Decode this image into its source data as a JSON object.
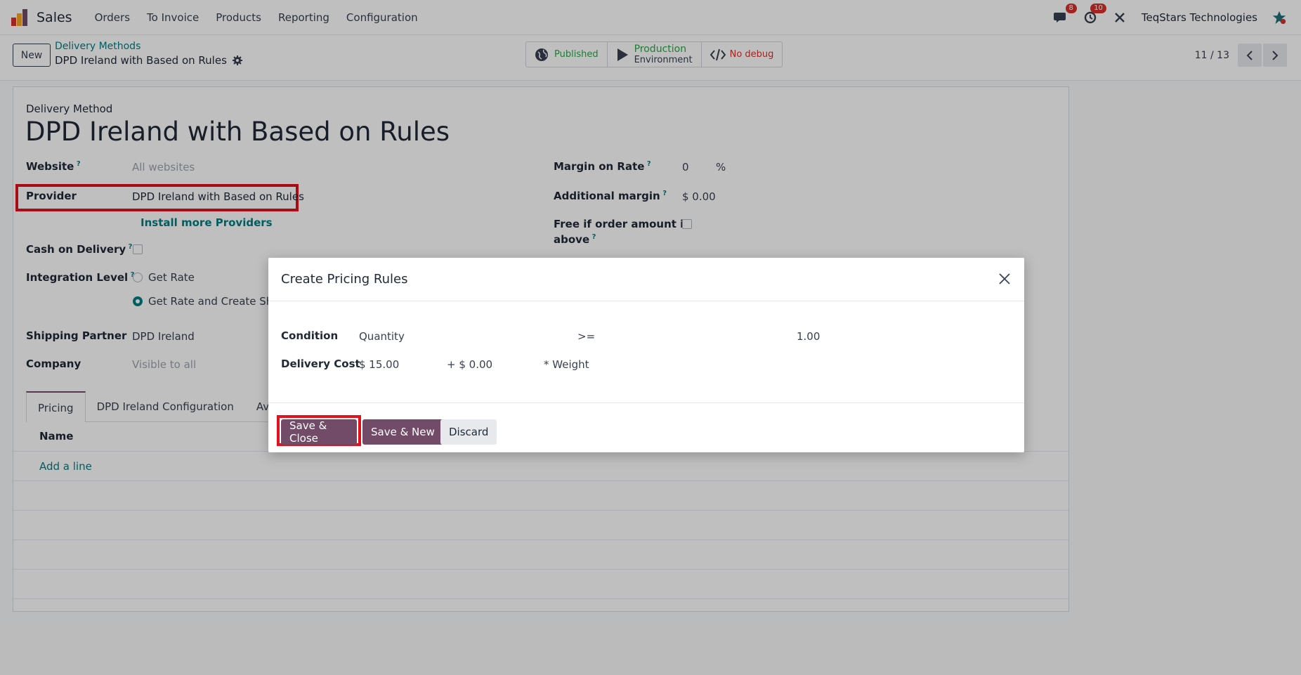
{
  "navbar": {
    "app_name": "Sales",
    "menu": [
      "Orders",
      "To Invoice",
      "Products",
      "Reporting",
      "Configuration"
    ],
    "messages_count": "8",
    "activities_count": "10",
    "company": "TeqStars Technologies"
  },
  "control_panel": {
    "new_label": "New",
    "breadcrumb_parent": "Delivery Methods",
    "breadcrumb_current": "DPD Ireland with Based on Rules",
    "published_label": "Published",
    "production_label": "Production",
    "environment_label": "Environment",
    "debug_label": "No debug",
    "pager": "11 / 13"
  },
  "form": {
    "section_label": "Delivery Method",
    "title": "DPD Ireland with Based on Rules",
    "website_label": "Website",
    "website_placeholder": "All websites",
    "provider_label": "Provider",
    "provider_value": "DPD Ireland with Based on Rules",
    "install_providers": "Install more Providers",
    "cod_label": "Cash on Delivery",
    "integration_label": "Integration Level",
    "integration_options": [
      "Get Rate",
      "Get Rate and Create Ship"
    ],
    "shipping_partner_label": "Shipping Partner",
    "shipping_partner_value": "DPD Ireland",
    "company_label": "Company",
    "company_placeholder": "Visible to all",
    "margin_rate_label": "Margin on Rate",
    "margin_rate_value": "0",
    "margin_rate_unit": "%",
    "additional_margin_label": "Additional margin",
    "additional_margin_value": "$ 0.00",
    "free_above_label_1": "Free if order amount is",
    "free_above_label_2": "above",
    "tabs": [
      "Pricing",
      "DPD Ireland Configuration",
      "Ava"
    ],
    "list_header": "Name",
    "add_line": "Add a line"
  },
  "modal": {
    "title": "Create Pricing Rules",
    "condition_label": "Condition",
    "condition_variable": "Quantity",
    "condition_operator": ">=",
    "condition_value": "1.00",
    "cost_label": "Delivery Cost",
    "cost_base": "$ 15.00",
    "cost_extra": "+ $ 0.00",
    "cost_factor": "* Weight",
    "save_close": "Save & Close",
    "save_new": "Save & New",
    "discard": "Discard"
  },
  "colors": {
    "brand": "#714b67",
    "link": "#017e84",
    "highlight": "#e3101d"
  }
}
